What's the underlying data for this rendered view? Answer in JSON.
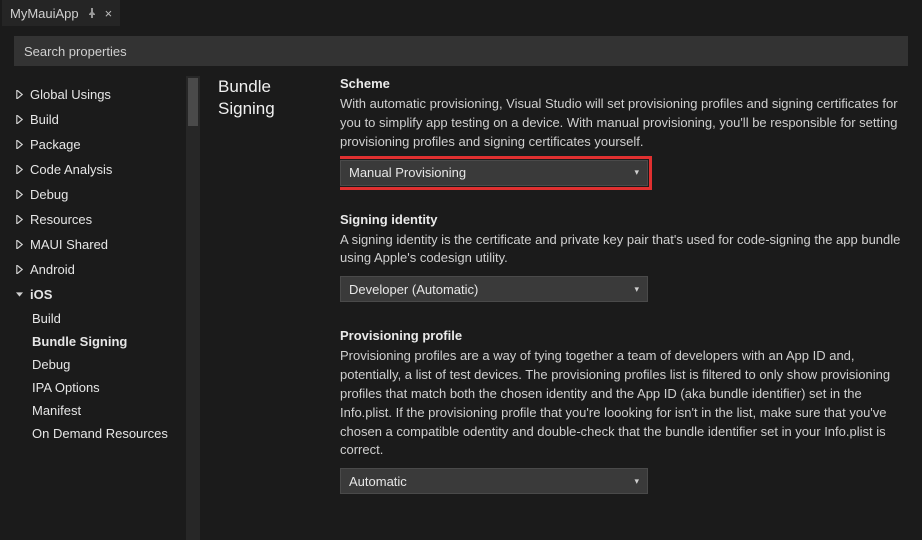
{
  "tab": {
    "title": "MyMauiApp"
  },
  "search": {
    "placeholder": "Search properties"
  },
  "section_title_line1": "Bundle",
  "section_title_line2": "Signing",
  "sidebar": {
    "items": [
      {
        "label": "Global Usings",
        "expanded": false
      },
      {
        "label": "Build",
        "expanded": false
      },
      {
        "label": "Package",
        "expanded": false
      },
      {
        "label": "Code Analysis",
        "expanded": false
      },
      {
        "label": "Debug",
        "expanded": false
      },
      {
        "label": "Resources",
        "expanded": false
      },
      {
        "label": "MAUI Shared",
        "expanded": false
      },
      {
        "label": "Android",
        "expanded": false
      },
      {
        "label": "iOS",
        "expanded": true,
        "bold": true,
        "children": [
          {
            "label": "Build"
          },
          {
            "label": "Bundle Signing",
            "bold": true
          },
          {
            "label": "Debug"
          },
          {
            "label": "IPA Options"
          },
          {
            "label": "Manifest"
          },
          {
            "label": "On Demand Resources"
          }
        ]
      }
    ]
  },
  "groups": {
    "scheme": {
      "title": "Scheme",
      "desc": "With automatic provisioning, Visual Studio will set provisioning profiles and signing certificates for you to simplify app testing on a device. With manual provisioning, you'll be responsible for setting provisioning profiles and signing certificates yourself.",
      "value": "Manual Provisioning"
    },
    "identity": {
      "title": "Signing identity",
      "desc": "A signing identity is the certificate and private key pair that's used for code-signing the app bundle using Apple's codesign utility.",
      "value": "Developer (Automatic)"
    },
    "profile": {
      "title": "Provisioning profile",
      "desc": "Provisioning profiles are a way of tying together a team of developers with an App ID and, potentially, a list of test devices. The provisioning profiles list is filtered to only show provisioning profiles that match both the chosen identity and the App ID (aka bundle identifier) set in the Info.plist. If the provisioning profile that you're loooking for isn't in the list, make sure that you've chosen a compatible odentity and double-check that the bundle identifier set in your Info.plist is correct.",
      "value": "Automatic"
    }
  }
}
